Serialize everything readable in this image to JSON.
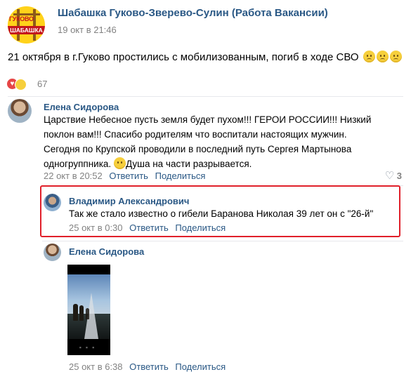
{
  "post": {
    "group_name": "Шабашка Гуково-Зверево-Сулин (Работа Вакансии)",
    "group_logo_text_top": "ГУКОВО",
    "group_logo_text_bottom": "ШАБАШКА",
    "date": "19 окт в 21:46",
    "text": "21 октября в г.Гуково простились с мобилизованным, погиб в ходе СВО",
    "reaction_count": "67"
  },
  "comments": [
    {
      "author": "Елена Сидорова",
      "lines": [
        "Царствие Небесное пусть земля будет пухом!!! ГЕРОИ РОССИИ!!! Низкий",
        "поклон вам!!! Спасибо родителям что воспитали настоящих мужчин.",
        "Сегодня по Крупской проводили в последний путь Сергея Мартынова",
        "одногруппника.",
        "Душа на части разрывается."
      ],
      "date": "22 окт в 20:52",
      "reply": "Ответить",
      "share": "Поделиться",
      "likes": "3"
    },
    {
      "author": "Владимир Александрович",
      "text": "Так же стало известно о гибели Баранова Николая 39 лет он с \"26-й\"",
      "date": "25 окт в 0:30",
      "reply": "Ответить",
      "share": "Поделиться"
    },
    {
      "author": "Елена Сидорова",
      "date": "25 окт в 6:38",
      "reply": "Ответить",
      "share": "Поделиться"
    }
  ],
  "colors": {
    "link": "#2a5885",
    "meta": "#828282",
    "highlight_border": "#e0202a"
  }
}
